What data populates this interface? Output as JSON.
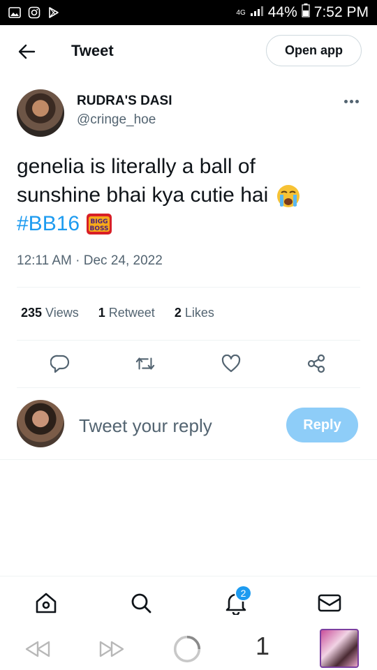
{
  "status_bar": {
    "network": "4G",
    "battery": "44%",
    "time": "7:52 PM",
    "icons_left": [
      "gallery-icon",
      "instagram-icon",
      "play-store-icon"
    ]
  },
  "header": {
    "title": "Tweet",
    "open_app_label": "Open app"
  },
  "tweet": {
    "author_name": "RUDRA'S DASI",
    "author_handle": "@cringe_hoe",
    "text_line1": "genelia is literally a ball of",
    "text_line2": "sunshine bhai kya cutie hai",
    "hashtag": "#BB16",
    "hashtag_emoji_text": "BIGG BOSS",
    "timestamp": "12:11 AM · Dec 24, 2022",
    "stats": {
      "views_count": "235",
      "views_label": "Views",
      "retweets_count": "1",
      "retweets_label": "Retweet",
      "likes_count": "2",
      "likes_label": "Likes"
    }
  },
  "reply_box": {
    "placeholder": "Tweet your reply",
    "button_label": "Reply"
  },
  "bottom_nav": {
    "notification_badge": "2"
  },
  "browser": {
    "tab_count": "1"
  },
  "colors": {
    "accent": "#1d9bf0",
    "reply_button": "#8ecdf8",
    "secondary_text": "#536471"
  }
}
